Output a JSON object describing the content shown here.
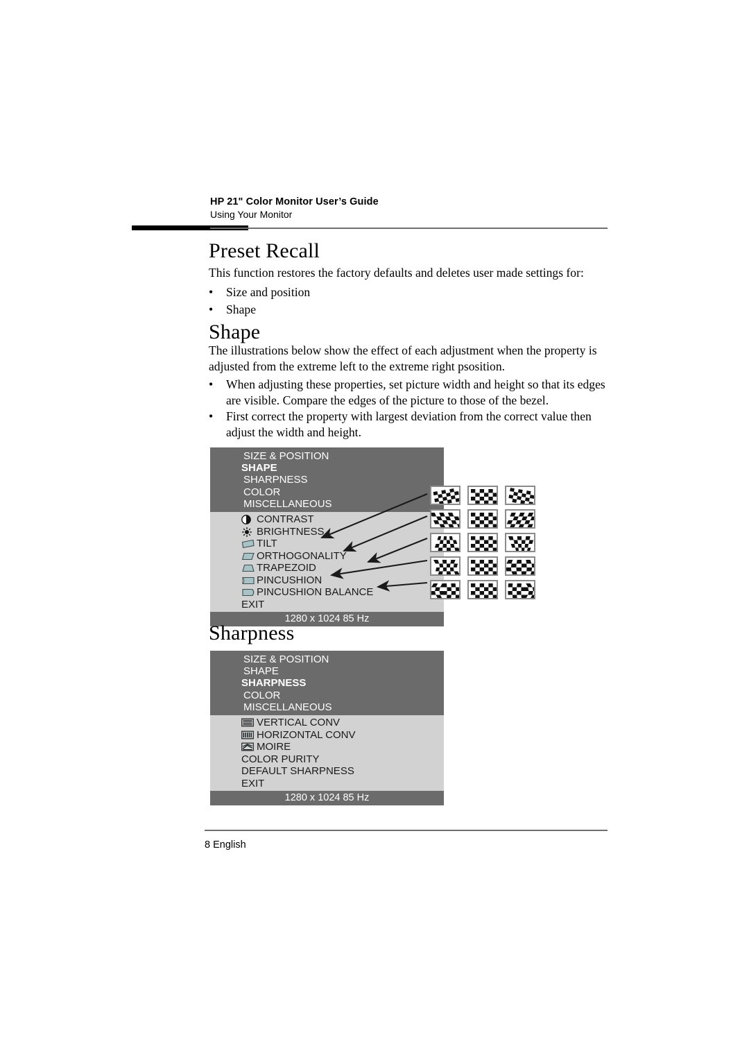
{
  "running_head": {
    "title": "HP 21\" Color Monitor User’s Guide",
    "subtitle": "Using Your Monitor"
  },
  "sections": {
    "preset_recall": {
      "heading": "Preset Recall",
      "intro": "This function restores the factory defaults and deletes user made settings for:",
      "bullets": [
        "Size and position",
        "Shape"
      ]
    },
    "shape": {
      "heading": "Shape",
      "intro": "The illustrations below show the effect of each adjustment when the property is adjusted from the extreme left to the extreme right psosition.",
      "bullets": [
        "When adjusting these properties, set picture width and height so that its edges are visible. Compare the edges of the picture to those of the bezel.",
        "First correct the property with largest deviation from the correct value then adjust the width and height."
      ]
    },
    "sharpness": {
      "heading": "Sharpness"
    }
  },
  "osd_shape": {
    "categories": [
      {
        "label": "SIZE & POSITION",
        "selected": false
      },
      {
        "label": "SHAPE",
        "selected": true
      },
      {
        "label": "SHARPNESS",
        "selected": false
      },
      {
        "label": "COLOR",
        "selected": false
      },
      {
        "label": "MISCELLANEOUS",
        "selected": false
      }
    ],
    "items": [
      {
        "label": "CONTRAST",
        "icon": "contrast-icon"
      },
      {
        "label": "BRIGHTNESS",
        "icon": "brightness-icon"
      },
      {
        "label": "TILT",
        "icon": "tilt-icon"
      },
      {
        "label": "ORTHOGONALITY",
        "icon": "orthogonality-icon"
      },
      {
        "label": "TRAPEZOID",
        "icon": "trapezoid-icon"
      },
      {
        "label": "PINCUSHION",
        "icon": "pincushion-icon"
      },
      {
        "label": "PINCUSHION BALANCE",
        "icon": "pincushion-balance-icon"
      },
      {
        "label": "EXIT",
        "icon": "none"
      }
    ],
    "footer": "1280 x 1024  85 Hz"
  },
  "osd_sharpness": {
    "categories": [
      {
        "label": "SIZE & POSITION",
        "selected": false
      },
      {
        "label": "SHAPE",
        "selected": false
      },
      {
        "label": "SHARPNESS",
        "selected": true
      },
      {
        "label": "COLOR",
        "selected": false
      },
      {
        "label": "MISCELLANEOUS",
        "selected": false
      }
    ],
    "items": [
      {
        "label": "VERTICAL CONV",
        "icon": "vertical-conv-icon"
      },
      {
        "label": "HORIZONTAL CONV",
        "icon": "horizontal-conv-icon"
      },
      {
        "label": "MOIRE",
        "icon": "moire-icon"
      },
      {
        "label": "COLOR PURITY",
        "icon": "none"
      },
      {
        "label": "DEFAULT SHARPNESS",
        "icon": "none"
      },
      {
        "label": "EXIT",
        "icon": "none"
      }
    ],
    "footer": "1280 x 1024  85 Hz"
  },
  "thumbnail_grid": {
    "rows": [
      {
        "property": "TILT",
        "variants": [
          "rotate-left",
          "normal",
          "rotate-right"
        ]
      },
      {
        "property": "ORTHOGONALITY",
        "variants": [
          "shear-left",
          "normal",
          "shear-right"
        ]
      },
      {
        "property": "TRAPEZOID",
        "variants": [
          "trapezoid-narrow-top",
          "normal",
          "trapezoid-wide-top"
        ]
      },
      {
        "property": "PINCUSHION",
        "variants": [
          "pincushion-in",
          "normal",
          "pincushion-out"
        ]
      },
      {
        "property": "PINCUSHION BALANCE",
        "variants": [
          "balance-left",
          "normal",
          "balance-right"
        ]
      }
    ]
  },
  "page_footer": "8 English",
  "colors": {
    "osd_header": "#6b6b6b",
    "osd_body": "#d2d2d2",
    "osd_footer": "#6b6b6b",
    "shape_icon_fill": "#a8c2c6",
    "rule": "#6e6e6e"
  }
}
